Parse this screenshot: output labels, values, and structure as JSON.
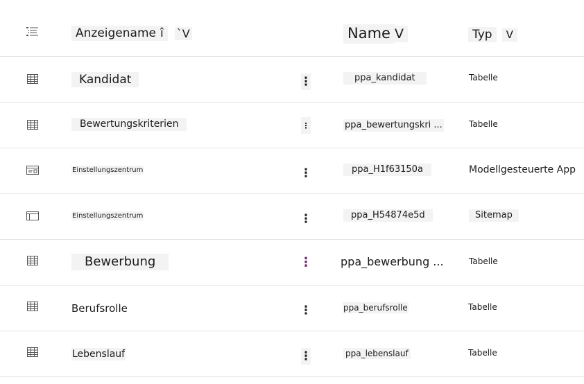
{
  "columns": {
    "display_name": "Anzeigename",
    "display_name_sort": "î",
    "display_name_menu": "`V",
    "name": "Name",
    "name_menu": "V",
    "type": "Typ",
    "type_menu": "V"
  },
  "rows": [
    {
      "icon": "table-icon",
      "display": "Kandidat",
      "name": "ppa_kandidat",
      "type": "Tabelle"
    },
    {
      "icon": "table-icon",
      "display": "Bewertungskriterien",
      "name": "ppa_bewertungskri ...",
      "type": "Tabelle"
    },
    {
      "icon": "model-driven-app-icon",
      "display": "Einstellungszentrum",
      "name": "ppa_H1f63150a",
      "type": "Modellgesteuerte App"
    },
    {
      "icon": "sitemap-icon",
      "display": "Einstellungszentrum",
      "name": "ppa_H54874e5d",
      "type": "Sitemap"
    },
    {
      "icon": "table-icon",
      "display": "Bewerbung",
      "name": "ppa_bewerbung ...",
      "type": "Tabelle"
    },
    {
      "icon": "table-icon",
      "display": "Berufsrolle",
      "name": "ppa_berufsrolle",
      "type": "Tabelle"
    },
    {
      "icon": "table-icon",
      "display": "Lebenslauf",
      "name": "ppa_lebenslauf",
      "type": "Tabelle"
    }
  ],
  "more_glyph": "⋮",
  "colors": {
    "accent_purple": "#742774",
    "divider": "#e6e6e6",
    "label_bg": "#f3f3f3"
  }
}
